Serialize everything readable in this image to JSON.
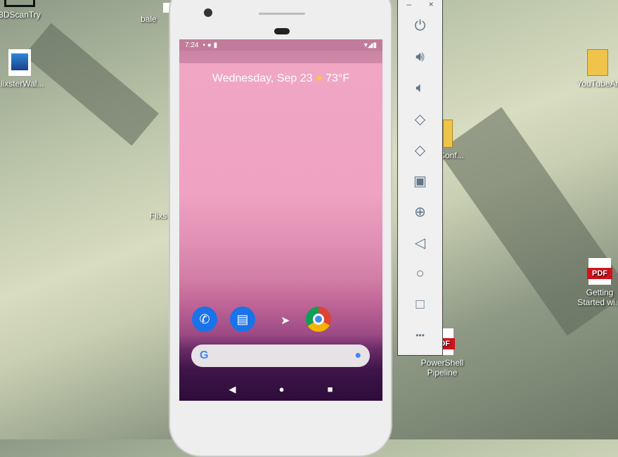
{
  "desktop": {
    "icons": [
      {
        "label": "3DScanTry"
      },
      {
        "label": "bale"
      },
      {
        "label": "FlixsterWal..."
      },
      {
        "label": "Flixs"
      },
      {
        "label": "Conf..."
      },
      {
        "label": "YouTubeAr"
      },
      {
        "label": "Getting Started wi..."
      },
      {
        "label": "PowerShell Pipeline"
      }
    ],
    "pdf_badge": "PDF"
  },
  "phone": {
    "status": {
      "time": "7:24"
    },
    "date_line": "Wednesday, Sep 23",
    "weather": "73°F",
    "dock": [
      "phone",
      "messages",
      "chrome"
    ],
    "search_logo": "G",
    "nav": {
      "back": "◀",
      "home": "●",
      "recents": "■"
    }
  },
  "toolbar": {
    "window_controls": {
      "minimize": "–",
      "close": "×"
    },
    "buttons": [
      "power",
      "volume-up",
      "volume-down",
      "rotate-left",
      "rotate-right",
      "screenshot",
      "zoom",
      "back",
      "home",
      "overview",
      "more"
    ],
    "more_label": "•••"
  }
}
